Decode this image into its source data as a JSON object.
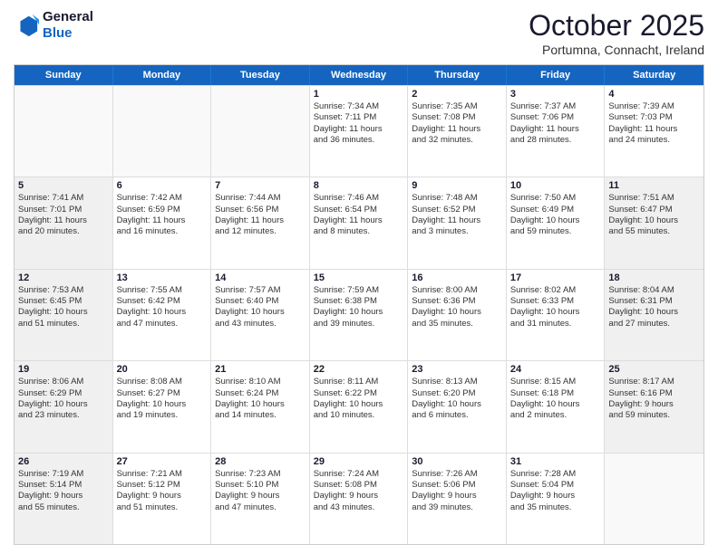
{
  "logo": {
    "line1": "General",
    "line2": "Blue"
  },
  "header": {
    "title": "October 2025",
    "subtitle": "Portumna, Connacht, Ireland"
  },
  "days": [
    "Sunday",
    "Monday",
    "Tuesday",
    "Wednesday",
    "Thursday",
    "Friday",
    "Saturday"
  ],
  "weeks": [
    [
      {
        "day": "",
        "text": "",
        "empty": true
      },
      {
        "day": "",
        "text": "",
        "empty": true
      },
      {
        "day": "",
        "text": "",
        "empty": true
      },
      {
        "day": "1",
        "text": "Sunrise: 7:34 AM\nSunset: 7:11 PM\nDaylight: 11 hours\nand 36 minutes."
      },
      {
        "day": "2",
        "text": "Sunrise: 7:35 AM\nSunset: 7:08 PM\nDaylight: 11 hours\nand 32 minutes."
      },
      {
        "day": "3",
        "text": "Sunrise: 7:37 AM\nSunset: 7:06 PM\nDaylight: 11 hours\nand 28 minutes."
      },
      {
        "day": "4",
        "text": "Sunrise: 7:39 AM\nSunset: 7:03 PM\nDaylight: 11 hours\nand 24 minutes."
      }
    ],
    [
      {
        "day": "5",
        "text": "Sunrise: 7:41 AM\nSunset: 7:01 PM\nDaylight: 11 hours\nand 20 minutes.",
        "shaded": true
      },
      {
        "day": "6",
        "text": "Sunrise: 7:42 AM\nSunset: 6:59 PM\nDaylight: 11 hours\nand 16 minutes."
      },
      {
        "day": "7",
        "text": "Sunrise: 7:44 AM\nSunset: 6:56 PM\nDaylight: 11 hours\nand 12 minutes."
      },
      {
        "day": "8",
        "text": "Sunrise: 7:46 AM\nSunset: 6:54 PM\nDaylight: 11 hours\nand 8 minutes."
      },
      {
        "day": "9",
        "text": "Sunrise: 7:48 AM\nSunset: 6:52 PM\nDaylight: 11 hours\nand 3 minutes."
      },
      {
        "day": "10",
        "text": "Sunrise: 7:50 AM\nSunset: 6:49 PM\nDaylight: 10 hours\nand 59 minutes."
      },
      {
        "day": "11",
        "text": "Sunrise: 7:51 AM\nSunset: 6:47 PM\nDaylight: 10 hours\nand 55 minutes.",
        "shaded": true
      }
    ],
    [
      {
        "day": "12",
        "text": "Sunrise: 7:53 AM\nSunset: 6:45 PM\nDaylight: 10 hours\nand 51 minutes.",
        "shaded": true
      },
      {
        "day": "13",
        "text": "Sunrise: 7:55 AM\nSunset: 6:42 PM\nDaylight: 10 hours\nand 47 minutes."
      },
      {
        "day": "14",
        "text": "Sunrise: 7:57 AM\nSunset: 6:40 PM\nDaylight: 10 hours\nand 43 minutes."
      },
      {
        "day": "15",
        "text": "Sunrise: 7:59 AM\nSunset: 6:38 PM\nDaylight: 10 hours\nand 39 minutes."
      },
      {
        "day": "16",
        "text": "Sunrise: 8:00 AM\nSunset: 6:36 PM\nDaylight: 10 hours\nand 35 minutes."
      },
      {
        "day": "17",
        "text": "Sunrise: 8:02 AM\nSunset: 6:33 PM\nDaylight: 10 hours\nand 31 minutes."
      },
      {
        "day": "18",
        "text": "Sunrise: 8:04 AM\nSunset: 6:31 PM\nDaylight: 10 hours\nand 27 minutes.",
        "shaded": true
      }
    ],
    [
      {
        "day": "19",
        "text": "Sunrise: 8:06 AM\nSunset: 6:29 PM\nDaylight: 10 hours\nand 23 minutes.",
        "shaded": true
      },
      {
        "day": "20",
        "text": "Sunrise: 8:08 AM\nSunset: 6:27 PM\nDaylight: 10 hours\nand 19 minutes."
      },
      {
        "day": "21",
        "text": "Sunrise: 8:10 AM\nSunset: 6:24 PM\nDaylight: 10 hours\nand 14 minutes."
      },
      {
        "day": "22",
        "text": "Sunrise: 8:11 AM\nSunset: 6:22 PM\nDaylight: 10 hours\nand 10 minutes."
      },
      {
        "day": "23",
        "text": "Sunrise: 8:13 AM\nSunset: 6:20 PM\nDaylight: 10 hours\nand 6 minutes."
      },
      {
        "day": "24",
        "text": "Sunrise: 8:15 AM\nSunset: 6:18 PM\nDaylight: 10 hours\nand 2 minutes."
      },
      {
        "day": "25",
        "text": "Sunrise: 8:17 AM\nSunset: 6:16 PM\nDaylight: 9 hours\nand 59 minutes.",
        "shaded": true
      }
    ],
    [
      {
        "day": "26",
        "text": "Sunrise: 7:19 AM\nSunset: 5:14 PM\nDaylight: 9 hours\nand 55 minutes.",
        "shaded": true
      },
      {
        "day": "27",
        "text": "Sunrise: 7:21 AM\nSunset: 5:12 PM\nDaylight: 9 hours\nand 51 minutes."
      },
      {
        "day": "28",
        "text": "Sunrise: 7:23 AM\nSunset: 5:10 PM\nDaylight: 9 hours\nand 47 minutes."
      },
      {
        "day": "29",
        "text": "Sunrise: 7:24 AM\nSunset: 5:08 PM\nDaylight: 9 hours\nand 43 minutes."
      },
      {
        "day": "30",
        "text": "Sunrise: 7:26 AM\nSunset: 5:06 PM\nDaylight: 9 hours\nand 39 minutes."
      },
      {
        "day": "31",
        "text": "Sunrise: 7:28 AM\nSunset: 5:04 PM\nDaylight: 9 hours\nand 35 minutes."
      },
      {
        "day": "",
        "text": "",
        "empty": true
      }
    ]
  ]
}
